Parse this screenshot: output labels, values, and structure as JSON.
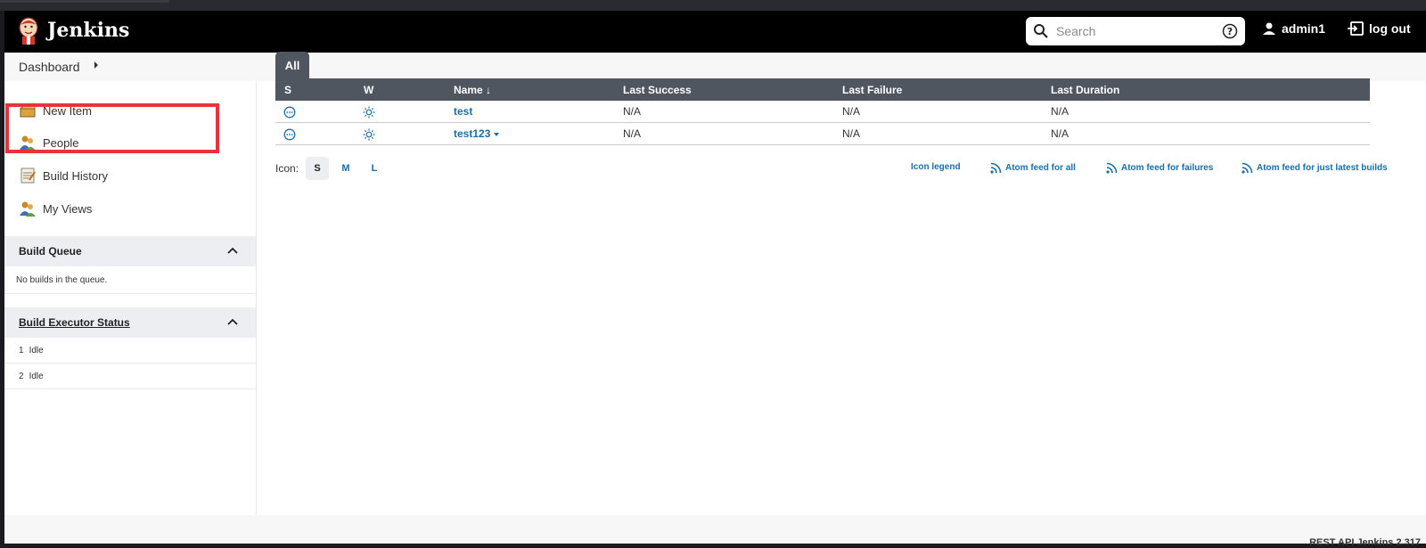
{
  "header": {
    "title": "Jenkins",
    "search_placeholder": "Search",
    "user": "admin1",
    "logout": "log out"
  },
  "breadcrumb": {
    "dashboard": "Dashboard"
  },
  "sidebar": {
    "items": [
      {
        "label": "New Item",
        "icon": "new-item-icon"
      },
      {
        "label": "People",
        "icon": "people-icon"
      },
      {
        "label": "Build History",
        "icon": "notepad-icon"
      },
      {
        "label": "My Views",
        "icon": "people-icon"
      }
    ],
    "build_queue": {
      "title": "Build Queue",
      "empty": "No builds in the queue."
    },
    "executors": {
      "title": "Build Executor Status",
      "rows": [
        {
          "num": "1",
          "status": "Idle"
        },
        {
          "num": "2",
          "status": "Idle"
        }
      ]
    }
  },
  "main": {
    "tab": "All",
    "columns": [
      "S",
      "W",
      "Name",
      "Last Success",
      "Last Failure",
      "Last Duration"
    ],
    "sort_indicator": "↓",
    "jobs": [
      {
        "name": "test",
        "last_success": "N/A",
        "last_failure": "N/A",
        "last_duration": "N/A"
      },
      {
        "name": "test123",
        "last_success": "N/A",
        "last_failure": "N/A",
        "last_duration": "N/A"
      }
    ],
    "icon_label": "Icon:",
    "icon_sizes": [
      "S",
      "M",
      "L"
    ],
    "links": {
      "legend": "Icon legend",
      "atom_all": "Atom feed for all",
      "atom_failures": "Atom feed for failures",
      "atom_latest": "Atom feed for just latest builds"
    }
  },
  "footer": {
    "text": "REST API     Jenkins 2.317"
  },
  "colors": {
    "header_bg": "#000000",
    "accent": "#1a6fa5",
    "highlight": "#e8333b",
    "table_head": "#4f5660"
  }
}
